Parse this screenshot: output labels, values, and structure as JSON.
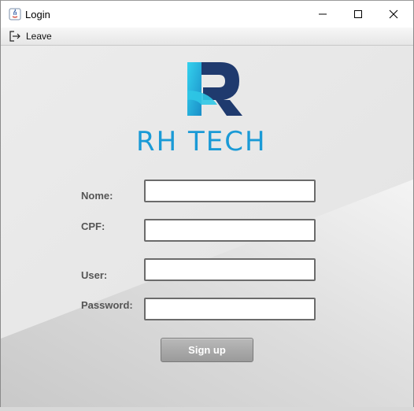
{
  "window": {
    "title": "Login"
  },
  "menubar": {
    "leave_label": "Leave"
  },
  "logo": {
    "letter": "R",
    "text": "RH TECH"
  },
  "form": {
    "nome_label": "Nome:",
    "cpf_label": "CPF:",
    "user_label": "User:",
    "password_label": "Password:",
    "nome_value": "",
    "cpf_value": "",
    "user_value": "",
    "password_value": "",
    "signup_label": "Sign up"
  },
  "colors": {
    "logo_blue": "#1a9ad6",
    "logo_navy": "#1f3a6e",
    "logo_cyan": "#2fc6e6",
    "button_gray": "#a8a8a8"
  }
}
